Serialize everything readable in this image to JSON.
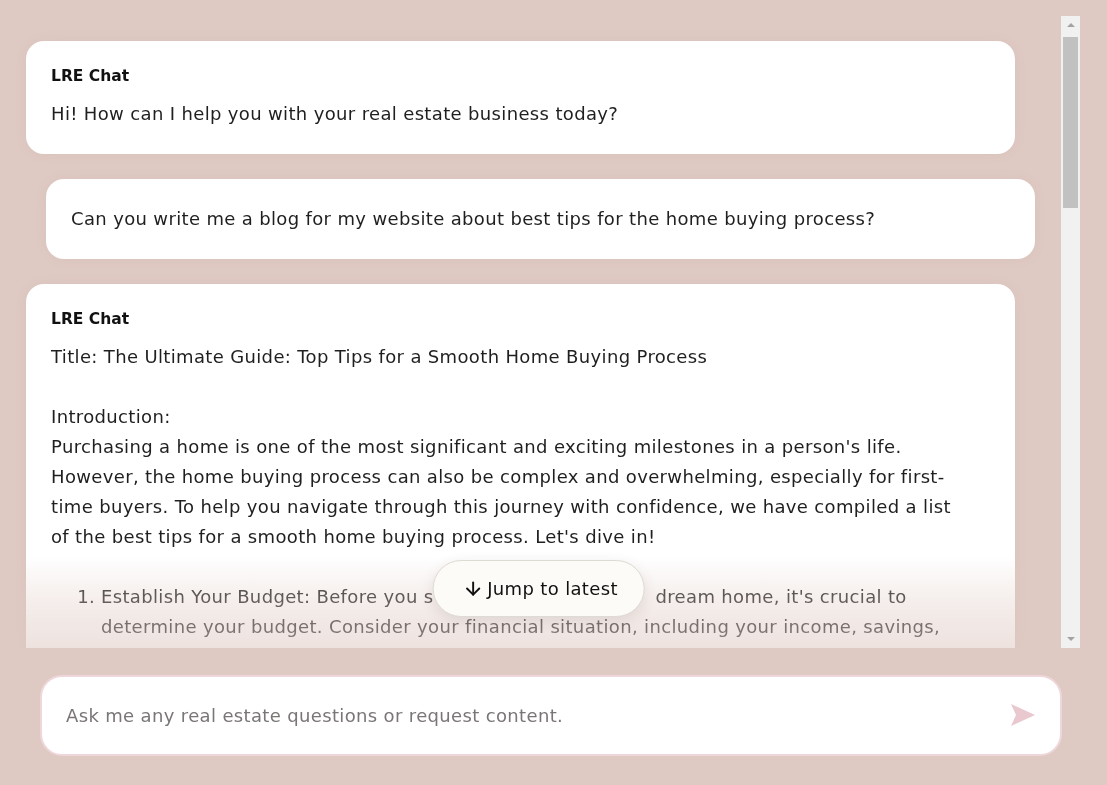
{
  "messages": [
    {
      "kind": "bot",
      "sender": "LRE Chat",
      "blocks": [
        {
          "kind": "paragraph",
          "text": "Hi! How can I help you with your real estate business today?"
        }
      ]
    },
    {
      "kind": "user",
      "blocks": [
        {
          "kind": "paragraph",
          "text": "Can you write me a blog for my website about best tips for the home buying process?"
        }
      ]
    },
    {
      "kind": "bot",
      "sender": "LRE Chat",
      "blocks": [
        {
          "kind": "paragraph",
          "text": "Title: The Ultimate Guide: Top Tips for a Smooth Home Buying Process"
        },
        {
          "kind": "paragraph",
          "text": "Introduction:\nPurchasing a home is one of the most significant and exciting milestones in a person's life. However, the home buying process can also be complex and overwhelming, especially for first-time buyers. To help you navigate through this journey with confidence, we have compiled a list of the best tips for a smooth home buying process. Let's dive in!"
        },
        {
          "kind": "list",
          "items": [
            {
              "number": "1.",
              "lines": [
                [
                  "Establish Your Budget: Before you s",
                  "dream home, it's crucial to"
                ],
                [
                  "determine your budget. Consider your financial situation, including your income, savings,"
                ]
              ]
            }
          ]
        }
      ]
    }
  ],
  "jump_button": {
    "label": "Jump to latest"
  },
  "composer": {
    "placeholder": "Ask me any real estate questions or request content."
  }
}
